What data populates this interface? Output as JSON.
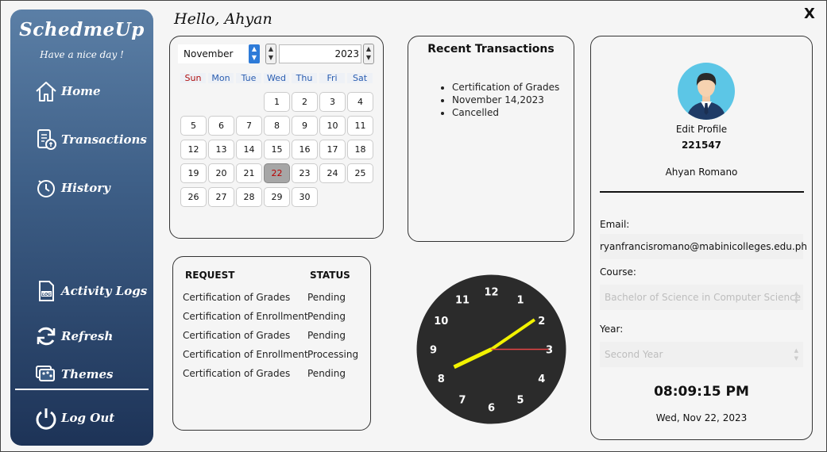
{
  "header": {
    "greeting": "Hello, Ahyan",
    "close_label": "X"
  },
  "sidebar": {
    "brand": "SchedmeUp",
    "tagline": "Have a nice day !",
    "items": [
      {
        "label": "Home",
        "icon": "home-icon"
      },
      {
        "label": "Transactions",
        "icon": "transactions-icon"
      },
      {
        "label": "History",
        "icon": "history-icon"
      },
      {
        "label": "Activity Logs",
        "icon": "log-icon"
      },
      {
        "label": "Refresh",
        "icon": "refresh-icon"
      },
      {
        "label": "Themes",
        "icon": "palette-icon"
      },
      {
        "label": "Log Out",
        "icon": "power-icon"
      }
    ]
  },
  "calendar": {
    "month": "November",
    "year": "2023",
    "weekdays": [
      "Sun",
      "Mon",
      "Tue",
      "Wed",
      "Thu",
      "Fri",
      "Sat"
    ],
    "days": [
      "1",
      "2",
      "3",
      "4",
      "5",
      "6",
      "7",
      "8",
      "9",
      "10",
      "11",
      "12",
      "13",
      "14",
      "15",
      "16",
      "17",
      "18",
      "19",
      "20",
      "21",
      "22",
      "23",
      "24",
      "25",
      "26",
      "27",
      "28",
      "29",
      "30"
    ],
    "first_weekday": 3,
    "selected_day": "22"
  },
  "recent": {
    "title": "Recent Transactions",
    "items": [
      "Certification of Grades",
      "November 14,2023",
      "Cancelled"
    ]
  },
  "requests": {
    "headers": [
      "REQUEST",
      "STATUS"
    ],
    "rows": [
      [
        "Certification of Grades",
        "Pending"
      ],
      [
        "Certification of Enrollment",
        "Pending"
      ],
      [
        "Certification of Grades",
        "Pending"
      ],
      [
        "Certification of Enrollment",
        "Processing"
      ],
      [
        "Certification of Grades",
        "Pending"
      ]
    ]
  },
  "clock": {
    "numbers": [
      "12",
      "1",
      "2",
      "3",
      "4",
      "5",
      "6",
      "7",
      "8",
      "9",
      "10",
      "11"
    ],
    "hour": 8,
    "minute": 9,
    "second": 15
  },
  "profile": {
    "edit_label": "Edit Profile",
    "id": "221547",
    "name": "Ahyan Romano",
    "email_label": "Email:",
    "email": "ryanfrancisromano@mabinicolleges.edu.ph",
    "course_label": "Course:",
    "course": "Bachelor of Science in Computer Science",
    "year_label": "Year:",
    "year": "Second Year",
    "time": "08:09:15 PM",
    "date": "Wed, Nov 22, 2023"
  },
  "colors": {
    "sidebar_top": "#5b7fa6",
    "sidebar_bottom": "#1d3357",
    "hour_hand": "#f2f200",
    "second_hand": "#e64545",
    "clock_face": "#2b2b2b"
  }
}
